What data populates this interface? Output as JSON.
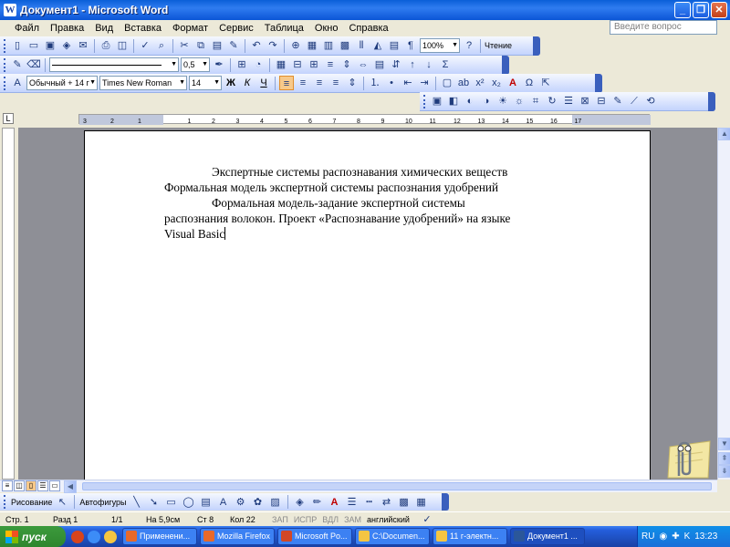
{
  "window": {
    "title": "Документ1 - Microsoft Word",
    "app_icon": "W"
  },
  "window_buttons": [
    "_",
    "❐",
    "✕"
  ],
  "menu": [
    "Файл",
    "Правка",
    "Вид",
    "Вставка",
    "Формат",
    "Сервис",
    "Таблица",
    "Окно",
    "Справка"
  ],
  "help_box": {
    "placeholder": "Введите вопрос"
  },
  "toolbar_standard": {
    "zoom": "100%",
    "reading_label": "Чтение"
  },
  "toolbar_tables": {
    "line_weight": "0,5"
  },
  "toolbar_formatting": {
    "style": "Обычный + 14 г",
    "font": "Times New Roman",
    "size": "14",
    "bold": "Ж",
    "italic": "К",
    "underline": "Ч"
  },
  "document": {
    "paragraphs": [
      "Экспертные системы распознавания химических веществ Формальная модель экспертной системы распознания удобрений",
      "Формальная модель-задание экспертной системы распознания волокон. Проект «Распознавание удобрений» на языке Visual Basic"
    ]
  },
  "ruler_numbers": [
    "3",
    "2",
    "1",
    "1",
    "2",
    "3",
    "4",
    "5",
    "6",
    "7",
    "8",
    "9",
    "10",
    "11",
    "12",
    "13",
    "14",
    "15",
    "16",
    "17"
  ],
  "draw_toolbar": {
    "draw_label": "Рисование",
    "autoshapes_label": "Автофигуры"
  },
  "statusbar": {
    "page": "Стр. 1",
    "section": "Разд 1",
    "pages": "1/1",
    "at": "На 5,9см",
    "line": "Ст 8",
    "col": "Кол 22",
    "rec": "ЗАП",
    "trk": "ИСПР",
    "ext": "ВДЛ",
    "ovr": "ЗАМ",
    "lang": "английский"
  },
  "taskbar": {
    "start_label": "пуск",
    "tasks": [
      {
        "label": "Применени...",
        "color": "#e8692a"
      },
      {
        "label": "Mozilla Firefox",
        "color": "#e8692a"
      },
      {
        "label": "Microsoft Po...",
        "color": "#d24726"
      },
      {
        "label": "C:\\Documen...",
        "color": "#f5c542"
      },
      {
        "label": "11 г-электн...",
        "color": "#f5c542"
      },
      {
        "label": "Документ1 ...",
        "color": "#2b579a"
      }
    ],
    "lang": "RU",
    "clock": "13:23"
  }
}
